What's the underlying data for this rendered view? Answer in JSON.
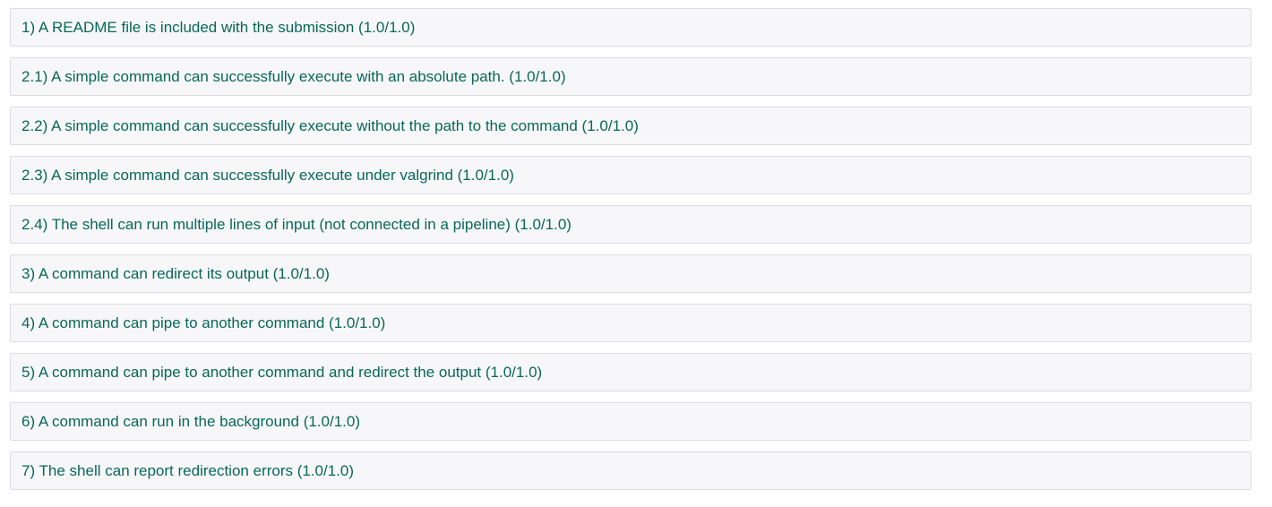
{
  "colors": {
    "text": "#08675a",
    "row_background": "#f7f7f9",
    "row_border": "#dcdce2"
  },
  "tests": [
    {
      "label": "1) A README file is included with the submission (1.0/1.0)"
    },
    {
      "label": "2.1) A simple command can successfully execute with an absolute path. (1.0/1.0)"
    },
    {
      "label": "2.2) A simple command can successfully execute without the path to the command (1.0/1.0)"
    },
    {
      "label": "2.3) A simple command can successfully execute under valgrind (1.0/1.0)"
    },
    {
      "label": "2.4) The shell can run multiple lines of input (not connected in a pipeline) (1.0/1.0)"
    },
    {
      "label": "3) A command can redirect its output (1.0/1.0)"
    },
    {
      "label": "4) A command can pipe to another command (1.0/1.0)"
    },
    {
      "label": "5) A command can pipe to another command and redirect the output (1.0/1.0)"
    },
    {
      "label": "6) A command can run in the background (1.0/1.0)"
    },
    {
      "label": "7) The shell can report redirection errors (1.0/1.0)"
    }
  ]
}
